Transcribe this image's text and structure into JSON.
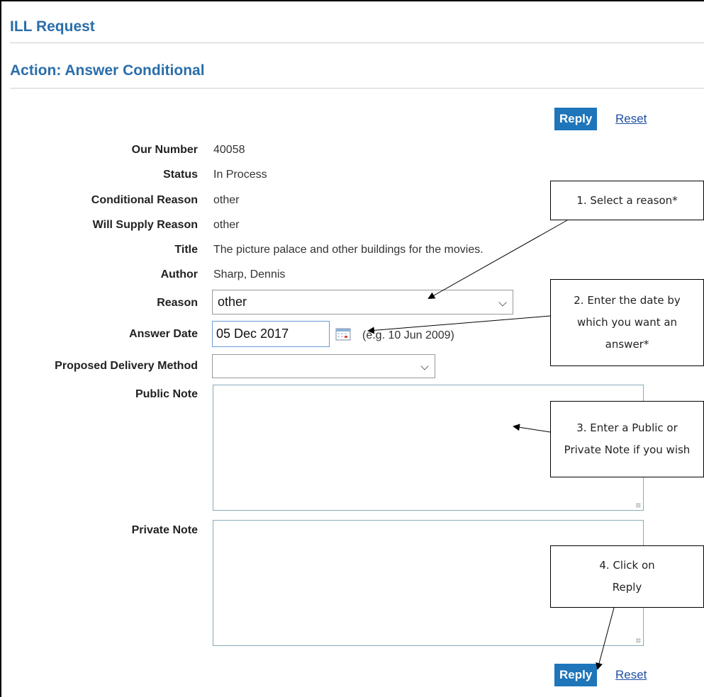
{
  "header": {
    "title": "ILL Request",
    "action": "Action: Answer Conditional"
  },
  "buttons": {
    "reply": "Reply",
    "reset": "Reset"
  },
  "fields": {
    "our_number": {
      "label": "Our Number",
      "value": "40058"
    },
    "status": {
      "label": "Status",
      "value": "In Process"
    },
    "conditional_reason": {
      "label": "Conditional Reason",
      "value": "other"
    },
    "will_supply_reason": {
      "label": "Will Supply Reason",
      "value": "other"
    },
    "title": {
      "label": "Title",
      "value": "The picture palace and other buildings for the movies."
    },
    "author": {
      "label": "Author",
      "value": "Sharp, Dennis"
    },
    "reason": {
      "label": "Reason",
      "value": "other"
    },
    "answer_date": {
      "label": "Answer Date",
      "value": "05 Dec 2017",
      "hint": "(e.g. 10 Jun 2009)"
    },
    "delivery": {
      "label": "Proposed Delivery Method",
      "value": ""
    },
    "public_note": {
      "label": "Public Note"
    },
    "private_note": {
      "label": "Private Note"
    }
  },
  "callouts": {
    "c1": "1. Select a reason*",
    "c2": "2. Enter the date by which you want an answer*",
    "c3": "3. Enter a Public or Private Note if you wish",
    "c4": "4. Click on Reply"
  },
  "colors": {
    "accent": "#1e75b9",
    "heading": "#2a6eaa",
    "link": "#1e4fa3"
  },
  "icons": {
    "calendar": "calendar-icon",
    "dropdown": "chevron-down-icon"
  }
}
